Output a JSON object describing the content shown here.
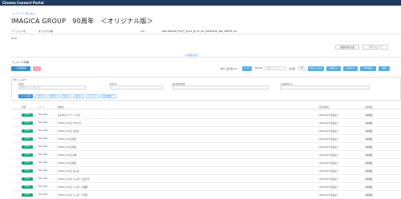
{
  "app": {
    "title": "Cinema Connect Portal"
  },
  "breadcrumb": "コンテンツ一覧に戻る",
  "page_title": "IMAGICA GROUP　90周年　＜オリジナル版＞",
  "meta": {
    "version_label": "バージョン名",
    "version_value": "オリジナル版",
    "cpl_label": "CPL",
    "cpl_value": "IMG-ORIGIN_FTR_F_JA-XX_JP_51_2K_20250516_IMA_SMPTE_OV",
    "note_label": "Note"
  },
  "right_buttons": [
    "掲載候補を追加",
    "ダウンロード"
  ],
  "expand_link": "∨ 詳細を表示",
  "section": {
    "title": "ブッキング情報",
    "add_button": "+ 新規追加",
    "delete_button": "−",
    "period_label": "下書き (最大数:00)",
    "period_selected": "すべて",
    "filter_label": "KAKUM",
    "filter_placeholder": "検索キーワード",
    "status_label": "表示数",
    "status_value": "10",
    "action_buttons": [
      "予約を入力する",
      "登録する",
      "承認する",
      "KDM配信",
      "取消"
    ]
  },
  "filter": {
    "heading": "▼ フィルター",
    "fields": [
      {
        "label": "劇場名",
        "placeholder": "劇場名を入力して絞り込み"
      },
      {
        "label": "館名/ID",
        "placeholder": ""
      },
      {
        "label": "配信期間(開始)",
        "placeholder": ""
      },
      {
        "label": "上映期間(終了)",
        "placeholder": ""
      }
    ],
    "tabs": [
      "すべての状態",
      "下書き中",
      "承認待ち",
      "予約済み",
      "配信済み",
      "キャンセル",
      "配信期間終了"
    ]
  },
  "grid": {
    "headers": [
      "状態",
      "コード",
      "劇場名",
      "配信開始日",
      "上映期間"
    ],
    "rows": [
      {
        "badge": "承認済み",
        "code": "H11_001",
        "name": "丸の内ピカデリーシネマ",
        "date": "2025/1/21 配信完了",
        "status": "上映開始"
      },
      {
        "badge": "承認済み",
        "code": "H11_001",
        "name": "TOHOシネマズ すすきの",
        "date": "2025/1/21 配信完了",
        "status": "上映開始"
      },
      {
        "badge": "承認済み",
        "code": "H11_002",
        "name": "TOHOシネマズ 日比谷",
        "date": "2025/1/21 配信完了",
        "status": "上映開始"
      },
      {
        "badge": "承認済み",
        "code": "H11_001",
        "name": "TOHOシネマズ仙台",
        "date": "2025/1/21 配信完了",
        "status": "上映開始"
      },
      {
        "badge": "承認済み",
        "code": "H11_001",
        "name": "TOHOシネマズ新宿",
        "date": "2025/1/21 配信完了",
        "status": "上映開始"
      },
      {
        "badge": "承認済み",
        "code": "H11_001",
        "name": "TOHOシネマズ川崎",
        "date": "2025/1/21 配信完了",
        "status": "上映開始"
      },
      {
        "badge": "承認済み",
        "code": "H11_001",
        "name": "TOHOシネマズ梅田",
        "date": "2025/1/21 配信完了",
        "status": "上映開始"
      },
      {
        "badge": "承認済み",
        "code": "H11_001",
        "name": "TOHOシネマズ なんば",
        "date": "2025/1/21 配信完了",
        "status": "上映開始"
      },
      {
        "badge": "承認済み",
        "code": "H11_001",
        "name": "TOHOシネマズ ららぽーと富士見",
        "date": "2025/1/21 配信完了",
        "status": "上映開始"
      },
      {
        "badge": "承認済み",
        "code": "H11_001",
        "name": "TOHOシネマズ ららぽーと船橋",
        "date": "2025/1/21 配信完了",
        "status": "上映開始"
      },
      {
        "badge": "承認済み",
        "code": "H11_001",
        "name": "TOHOシネマズ ららぽーと門真",
        "date": "2025/1/21 配信完了",
        "status": "上映開始"
      }
    ]
  },
  "colors": {
    "topbar": "#1e3a5f",
    "primary": "#2f8fd8",
    "badge": "#1aa37a",
    "pink": "#f3a6b6",
    "link": "#3a8fd6"
  }
}
